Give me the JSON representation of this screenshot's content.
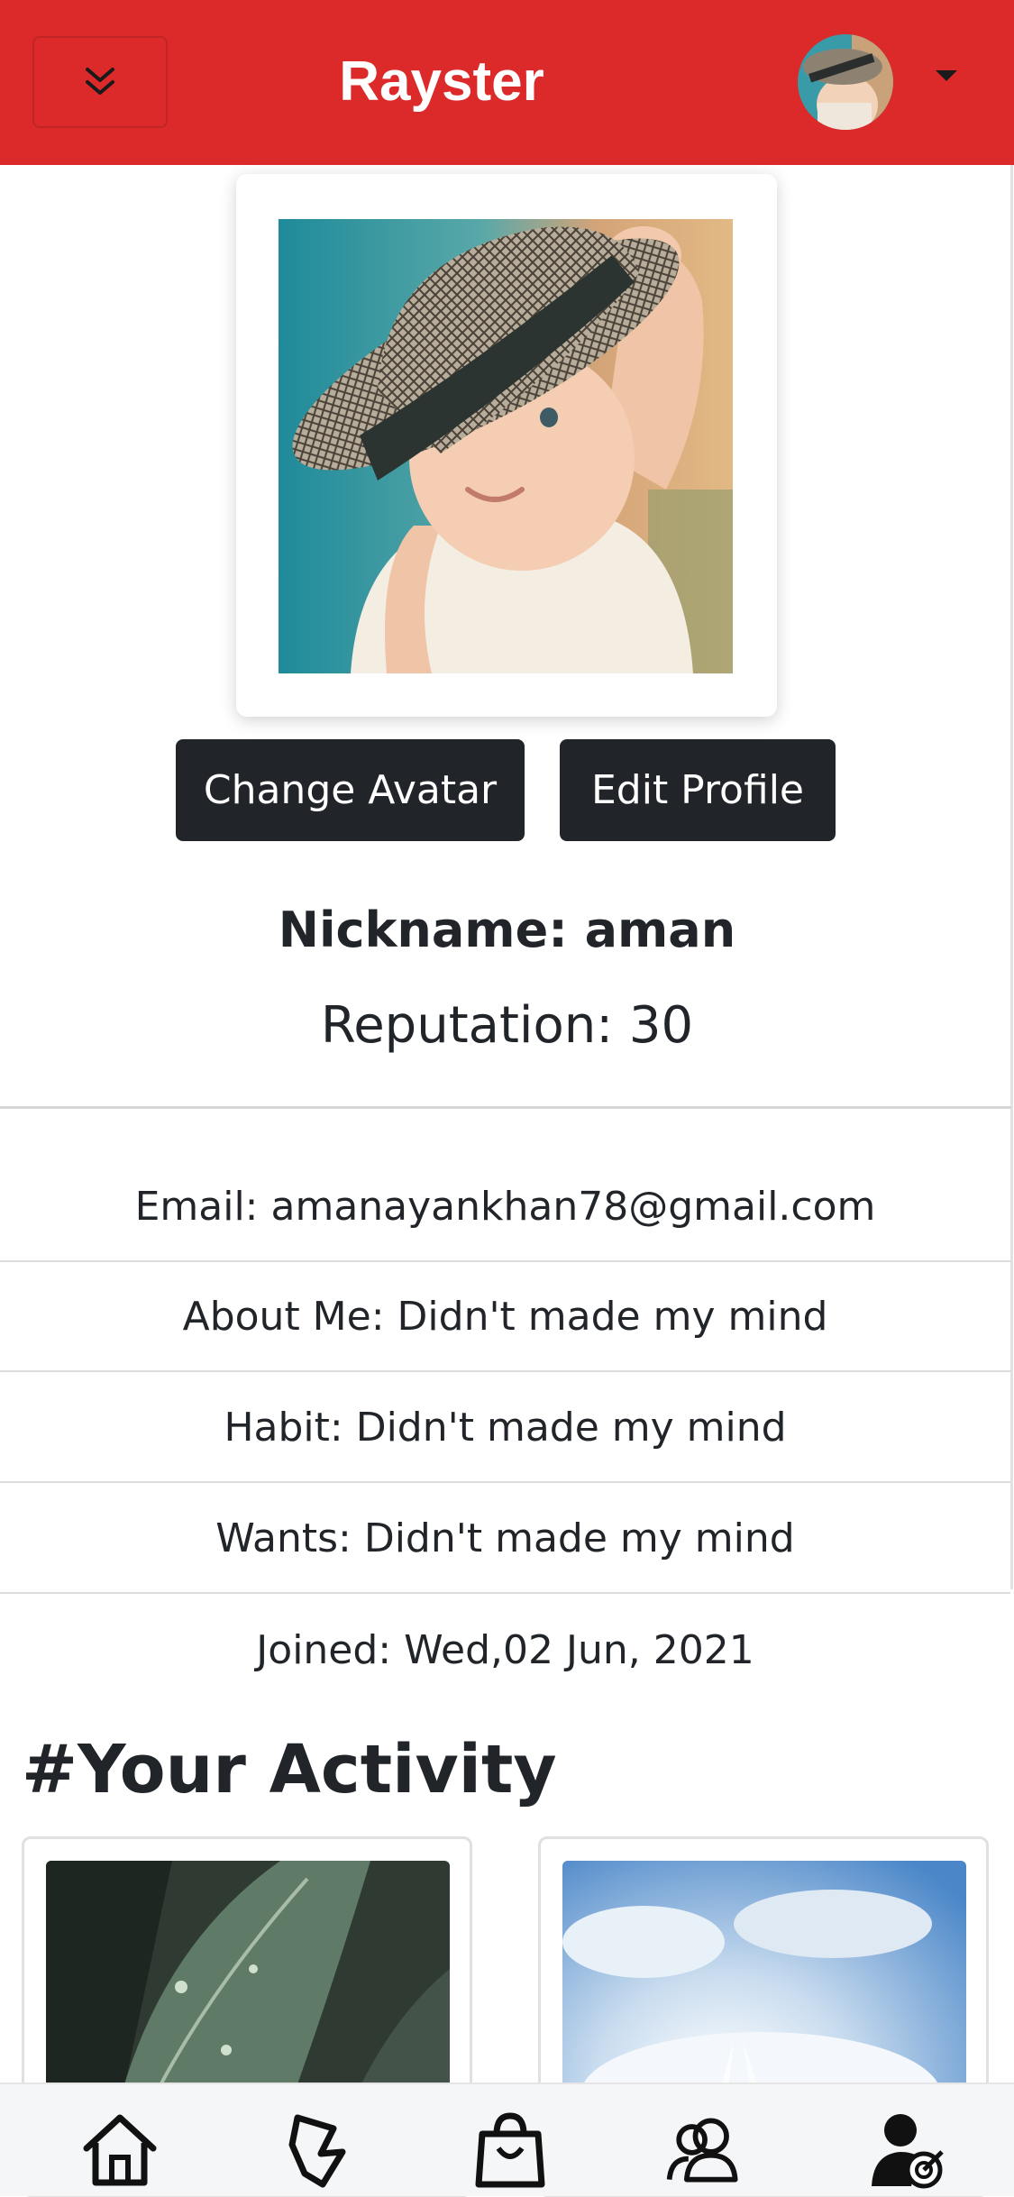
{
  "header": {
    "brand": "Rayster",
    "toggle_icon": "chevron-double-down-icon",
    "menu_caret_icon": "caret-down-icon",
    "background": "#dc2a2a"
  },
  "profile": {
    "change_avatar_label": "Change Avatar",
    "edit_profile_label": "Edit Profile",
    "nickname": "Nickname: aman",
    "reputation": "Reputation: 30"
  },
  "info": {
    "email": "Email: amanayankhan78@gmail.com",
    "about": "About Me: Didn't made my mind",
    "habit": "Habit: Didn't made my mind",
    "wants": "Wants: Didn't made my mind",
    "joined": "Joined: Wed,02 Jun, 2021"
  },
  "activity": {
    "title": "#Your Activity"
  },
  "bottom_nav": [
    {
      "icon": "home-icon"
    },
    {
      "icon": "stickers-icon"
    },
    {
      "icon": "shopping-bag-icon"
    },
    {
      "icon": "people-icon"
    },
    {
      "icon": "user-target-icon"
    }
  ]
}
